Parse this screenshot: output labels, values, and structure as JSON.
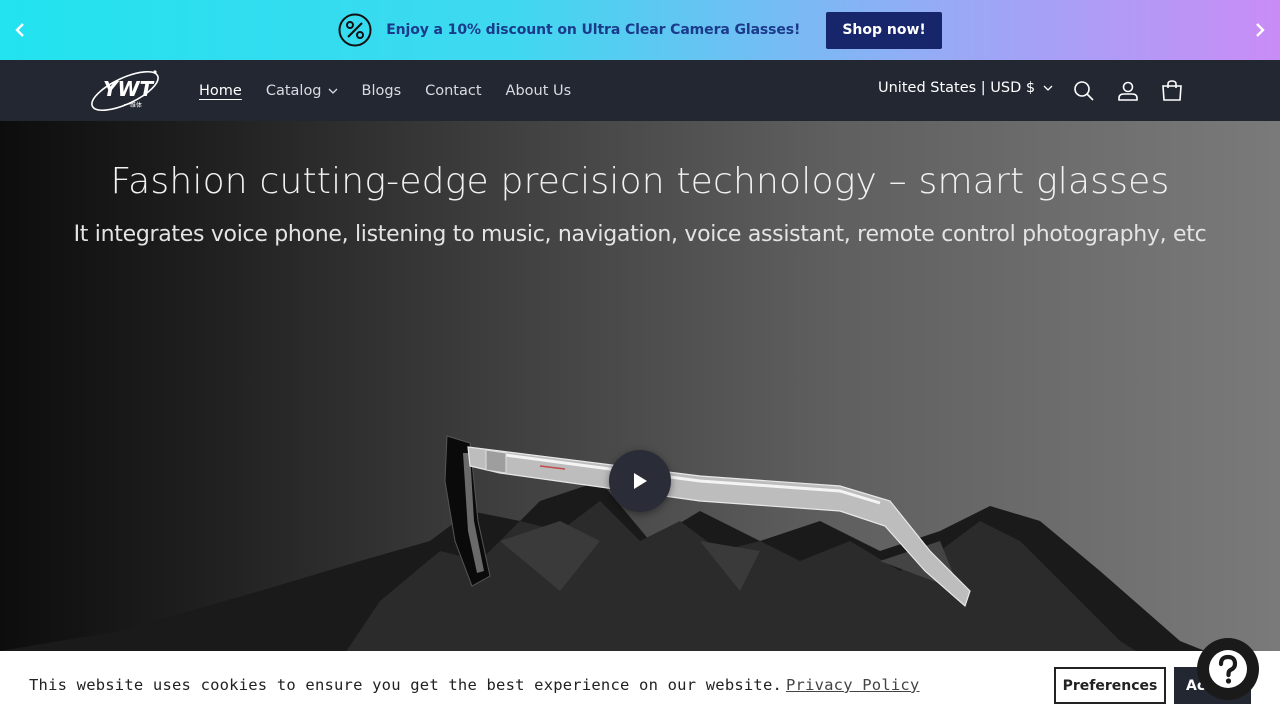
{
  "announcement": {
    "message": "Enjoy a 10% discount on Ultra Clear Camera Glasses!",
    "button_label": "Shop now!"
  },
  "header": {
    "logo_text": "YWT",
    "logo_subtext": "一维体",
    "nav": [
      "Home",
      "Catalog",
      "Blogs",
      "Contact",
      "About Us"
    ],
    "active_nav": "Home",
    "country_selector": "United States | USD $"
  },
  "hero": {
    "title": "Fashion cutting-edge precision technology – smart glasses",
    "subtitle": "It integrates voice phone, listening to music, navigation, voice assistant, remote control photography, etc"
  },
  "cookie_bar": {
    "message": "This website uses cookies to ensure you get the best experience on our website.",
    "privacy_link": "Privacy Policy",
    "preferences_label": "Preferences",
    "accept_label": "Accept"
  },
  "colors": {
    "announce_text": "#1b3a8a",
    "shop_button": "#17256b",
    "header_bg": "#232732"
  }
}
